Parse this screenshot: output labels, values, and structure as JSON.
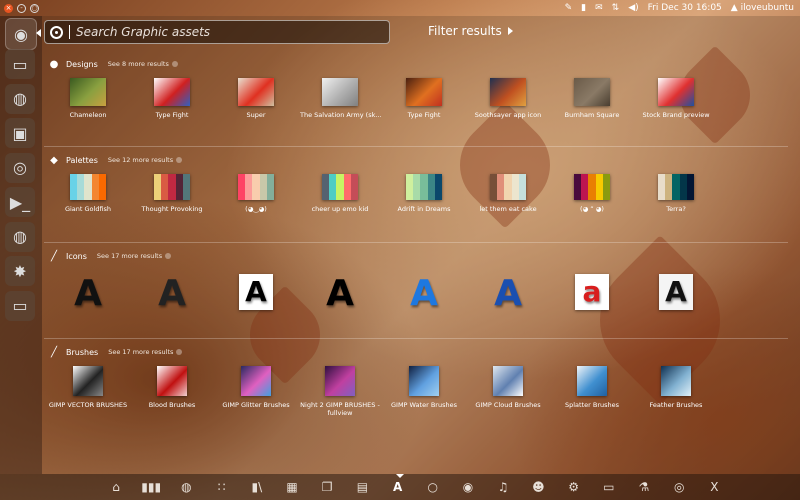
{
  "panel": {
    "datetime": "Fri Dec 30 16:05",
    "username": "iloveubuntu",
    "indicator_icons": [
      "keyboard-icon",
      "battery-icon",
      "mail-icon",
      "network-icon",
      "volume-icon"
    ]
  },
  "dash": {
    "search_placeholder": "Search Graphic assets",
    "filter_label": "Filter results"
  },
  "categories": [
    {
      "title": "Designs",
      "see_more": "See 8 more results",
      "icon": "lightbulb-icon",
      "items": [
        {
          "label": "Chameleon",
          "colors": [
            "#3a5a20",
            "#8aa040",
            "#c8a040"
          ]
        },
        {
          "label": "Type Fight",
          "colors": [
            "#ffffff",
            "#d02020",
            "#3060c0"
          ]
        },
        {
          "label": "Super",
          "colors": [
            "#e8e0d0",
            "#e03020",
            "#d0c0a0"
          ]
        },
        {
          "label": "The Salvation Army (sk...",
          "colors": [
            "#f0f0f0",
            "#b0b0b0",
            "#808080"
          ]
        },
        {
          "label": "Type Fight",
          "colors": [
            "#4a2010",
            "#e07020",
            "#c03020"
          ]
        },
        {
          "label": "Soothsayer app icon",
          "colors": [
            "#203050",
            "#c05020",
            "#e0a040"
          ]
        },
        {
          "label": "Burnham Square",
          "colors": [
            "#6a5a48",
            "#8a7a66",
            "#4a3e30"
          ]
        },
        {
          "label": "Stock Brand preview",
          "colors": [
            "#ffffff",
            "#e03030",
            "#2050a0"
          ]
        }
      ]
    },
    {
      "title": "Palettes",
      "see_more": "See 12 more results",
      "icon": "palette-icon",
      "items": [
        {
          "label": "Giant Goldfish",
          "colors": [
            "#69d2e7",
            "#a7dbd8",
            "#e0e4cc",
            "#f38630",
            "#fa6900"
          ]
        },
        {
          "label": "Thought Provoking",
          "colors": [
            "#ecd078",
            "#d95b43",
            "#c02942",
            "#542437",
            "#53777a"
          ]
        },
        {
          "label": "(◕‿◕)",
          "colors": [
            "#fe4365",
            "#fc9d9a",
            "#f9cdad",
            "#c8c8a9",
            "#83af9b"
          ]
        },
        {
          "label": "cheer up emo kid",
          "colors": [
            "#556270",
            "#4ecdc4",
            "#c7f464",
            "#ff6b6b",
            "#c44d58"
          ]
        },
        {
          "label": "Adrift in Dreams",
          "colors": [
            "#cff09e",
            "#a8dba8",
            "#79bd9a",
            "#3b8686",
            "#0b486b"
          ]
        },
        {
          "label": "let them eat cake",
          "colors": [
            "#774f38",
            "#e08e79",
            "#f1d4af",
            "#ece5ce",
            "#c5e0dc"
          ]
        },
        {
          "label": "(◕ ” ◕)",
          "colors": [
            "#490a3d",
            "#bd1550",
            "#e97f02",
            "#f8ca00",
            "#8a9b0f"
          ]
        },
        {
          "label": "Terra?",
          "colors": [
            "#e8ddcb",
            "#cdb380",
            "#036564",
            "#033649",
            "#031634"
          ]
        }
      ]
    },
    {
      "title": "Icons",
      "see_more": "See 17 more results",
      "icon": "brush-icon",
      "items": [
        {
          "glyph": "A",
          "color": "#111111",
          "bg": "none"
        },
        {
          "glyph": "A",
          "color": "#222222",
          "bg": "none"
        },
        {
          "glyph": "A",
          "color": "#000000",
          "bg": "#ffffff"
        },
        {
          "glyph": "A",
          "color": "#000000",
          "bg": "none"
        },
        {
          "glyph": "A",
          "color": "#1e78e0",
          "bg": "none"
        },
        {
          "glyph": "A",
          "color": "#1a4fb0",
          "bg": "none"
        },
        {
          "glyph": "a",
          "color": "#d81e1e",
          "bg": "#ffffff"
        },
        {
          "glyph": "A",
          "color": "#111111",
          "bg": "#f4f4f4"
        }
      ]
    },
    {
      "title": "Brushes",
      "see_more": "See 17 more results",
      "icon": "brush-icon",
      "items": [
        {
          "label": "GIMP VECTOR BRUSHES",
          "colors": [
            "#ffffff",
            "#222222",
            "#888888"
          ]
        },
        {
          "label": "Blood Brushes",
          "colors": [
            "#ffffff",
            "#c01010",
            "#f0d0d0"
          ]
        },
        {
          "label": "GIMP Glitter Brushes",
          "colors": [
            "#2a2a60",
            "#e060c0",
            "#40a0e0"
          ]
        },
        {
          "label": "Night 2 GIMP BRUSHES - fullview",
          "colors": [
            "#301040",
            "#c040a0",
            "#8060c0"
          ]
        },
        {
          "label": "GIMP Water Brushes",
          "colors": [
            "#102040",
            "#60a0e0",
            "#a0d0f0"
          ]
        },
        {
          "label": "GIMP Cloud Brushes",
          "colors": [
            "#e0e8f0",
            "#6080b0",
            "#ffffff"
          ]
        },
        {
          "label": "Splatter Brushes",
          "colors": [
            "#f0f4f8",
            "#4090d0",
            "#2060a0"
          ]
        },
        {
          "label": "Feather Brushes",
          "colors": [
            "#103050",
            "#80b0d0",
            "#e0f0f8"
          ]
        }
      ]
    }
  ],
  "dock": {
    "lenses": [
      "home-icon",
      "apps-icon",
      "files-icon",
      "music-lens-icon",
      "books-icon",
      "calendar-icon",
      "docs-icon",
      "notes-icon",
      "graphics-icon",
      "circle-icon",
      "radar-icon",
      "music-icon",
      "reddit-icon",
      "gadgets-icon",
      "folder-icon",
      "flask-icon",
      "globe-icon",
      "x-icon"
    ],
    "lens_glyphs": [
      "⌂",
      "▮▮▮",
      "◍",
      "∷",
      "▮\\",
      "▦",
      "❐",
      "▤",
      "A",
      "○",
      "◉",
      "♫",
      "☻",
      "⚙",
      "▭",
      "⚗",
      "◎",
      "X"
    ],
    "active_index": 8
  },
  "launcher": {
    "items": [
      "dash-home-icon",
      "files-icon",
      "firefox-icon",
      "folder-icon",
      "settings-icon",
      "terminal-icon",
      "chrome-icon",
      "eclipse-icon",
      "window-icon"
    ],
    "glyphs": [
      "◉",
      "▭",
      "◍",
      "▣",
      "◎",
      "▶_",
      "◍",
      "✸",
      "▭"
    ]
  }
}
